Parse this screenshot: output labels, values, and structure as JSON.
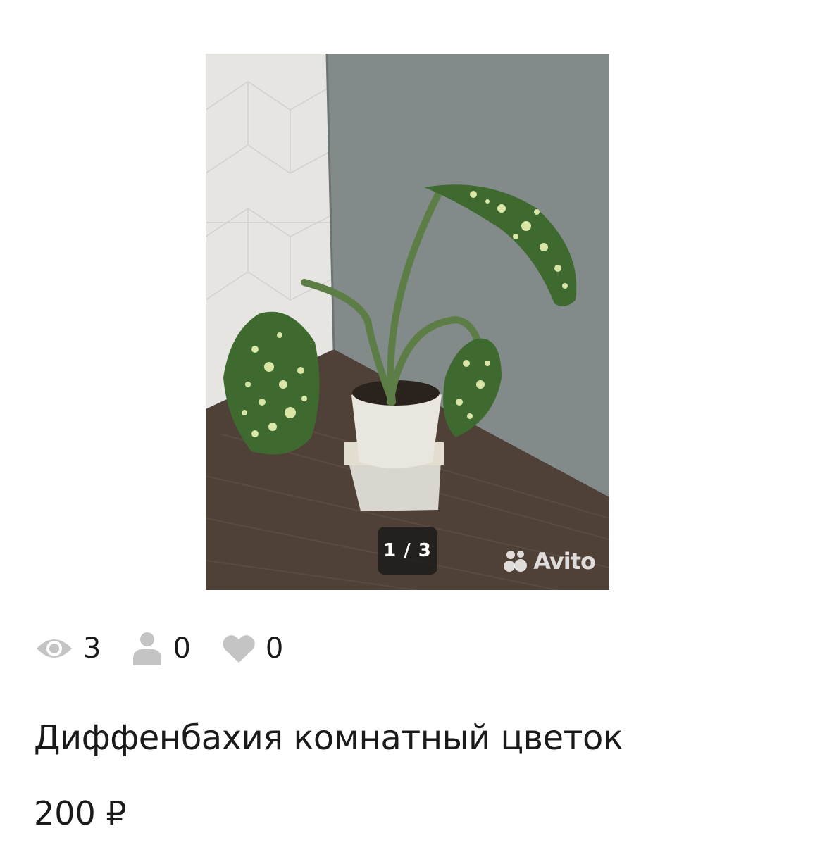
{
  "gallery": {
    "counter": "1 / 3",
    "watermark": "Avito",
    "current_index": 1,
    "total": 3
  },
  "stats": {
    "views": "3",
    "contacts": "0",
    "favorites": "0"
  },
  "listing": {
    "title": "Диффенбахия комнатный цветок",
    "price": "200 ₽"
  },
  "colors": {
    "text": "#1a1a1a",
    "icon_gray": "#c4c4c4",
    "wall_gray": "#7e8686",
    "table_brown": "#4f4138",
    "leaf_green": "#3e6a2f"
  }
}
